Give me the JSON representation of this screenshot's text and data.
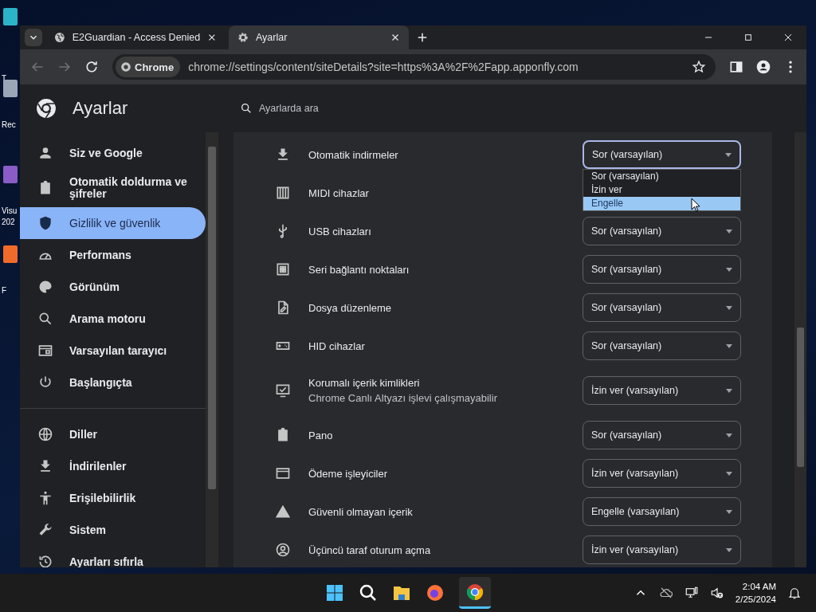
{
  "desktop_icons": [
    {
      "label": "T",
      "color": "#2bb3c9"
    },
    {
      "label": "Rec",
      "color": "#9aa6b8"
    },
    {
      "label": "Visu 202",
      "color": "#8a5cc7"
    },
    {
      "label": "F",
      "color": "#f06a2a"
    }
  ],
  "tabs": [
    {
      "title": "E2Guardian - Access Denied",
      "kind": "web",
      "selected": false
    },
    {
      "title": "Ayarlar",
      "kind": "settings",
      "selected": true
    }
  ],
  "address_bar": {
    "chip": "Chrome",
    "url": "chrome://settings/content/siteDetails?site=https%3A%2F%2Fapp.apponfly.com"
  },
  "settings_header": {
    "title": "Ayarlar",
    "search_placeholder": "Ayarlarda ara"
  },
  "sidebar": {
    "groups": [
      [
        {
          "label": "Siz ve Google",
          "kind": "person",
          "selected": false
        },
        {
          "label": "Otomatik doldurma ve şifreler",
          "kind": "clipboard",
          "selected": false
        },
        {
          "label": "Gizlilik ve güvenlik",
          "kind": "shield",
          "selected": true
        },
        {
          "label": "Performans",
          "kind": "gauge",
          "selected": false
        },
        {
          "label": "Görünüm",
          "kind": "palette",
          "selected": false
        },
        {
          "label": "Arama motoru",
          "kind": "search",
          "selected": false
        },
        {
          "label": "Varsayılan tarayıcı",
          "kind": "browser",
          "selected": false
        },
        {
          "label": "Başlangıçta",
          "kind": "power",
          "selected": false
        }
      ],
      [
        {
          "label": "Diller",
          "kind": "globe",
          "selected": false
        },
        {
          "label": "İndirilenler",
          "kind": "download",
          "selected": false
        },
        {
          "label": "Erişilebilirlik",
          "kind": "accessibility",
          "selected": false
        },
        {
          "label": "Sistem",
          "kind": "wrench",
          "selected": false
        },
        {
          "label": "Ayarları sıfırla",
          "kind": "history",
          "selected": false
        }
      ]
    ]
  },
  "permissions": [
    {
      "label": "Otomatik indirmeler",
      "kind": "download",
      "value": "Sor (varsayılan)",
      "open": true,
      "options": [
        {
          "label": "Sor (varsayılan)",
          "highlighted": false
        },
        {
          "label": "İzin ver",
          "highlighted": false
        },
        {
          "label": "Engelle",
          "highlighted": true
        }
      ]
    },
    {
      "label": "MIDI cihazlar",
      "kind": "piano"
    },
    {
      "label": "USB cihazları",
      "kind": "usb",
      "value": "Sor (varsayılan)",
      "open": false
    },
    {
      "label": "Seri bağlantı noktaları",
      "kind": "serial",
      "value": "Sor (varsayılan)",
      "open": false
    },
    {
      "label": "Dosya düzenleme",
      "kind": "file",
      "value": "Sor (varsayılan)",
      "open": false
    },
    {
      "label": "HID cihazlar",
      "kind": "gamepad",
      "value": "Sor (varsayılan)",
      "open": false
    },
    {
      "label": "Korumalı içerik kimlikleri",
      "sublabel": "Chrome Canlı Altyazı işlevi çalışmayabilir",
      "kind": "monitor",
      "value": "İzin ver (varsayılan)",
      "open": false
    },
    {
      "label": "Pano",
      "kind": "clipboard",
      "value": "Sor (varsayılan)",
      "open": false
    },
    {
      "label": "Ödeme işleyiciler",
      "kind": "card",
      "value": "İzin ver (varsayılan)",
      "open": false
    },
    {
      "label": "Güvenli olmayan içerik",
      "kind": "warning",
      "value": "Engelle (varsayılan)",
      "open": false
    },
    {
      "label": "Üçüncü taraf oturum açma",
      "kind": "account",
      "value": "İzin ver (varsayılan)",
      "open": false
    }
  ],
  "taskbar": {
    "time": "2:04 AM",
    "date": "2/25/2024"
  }
}
